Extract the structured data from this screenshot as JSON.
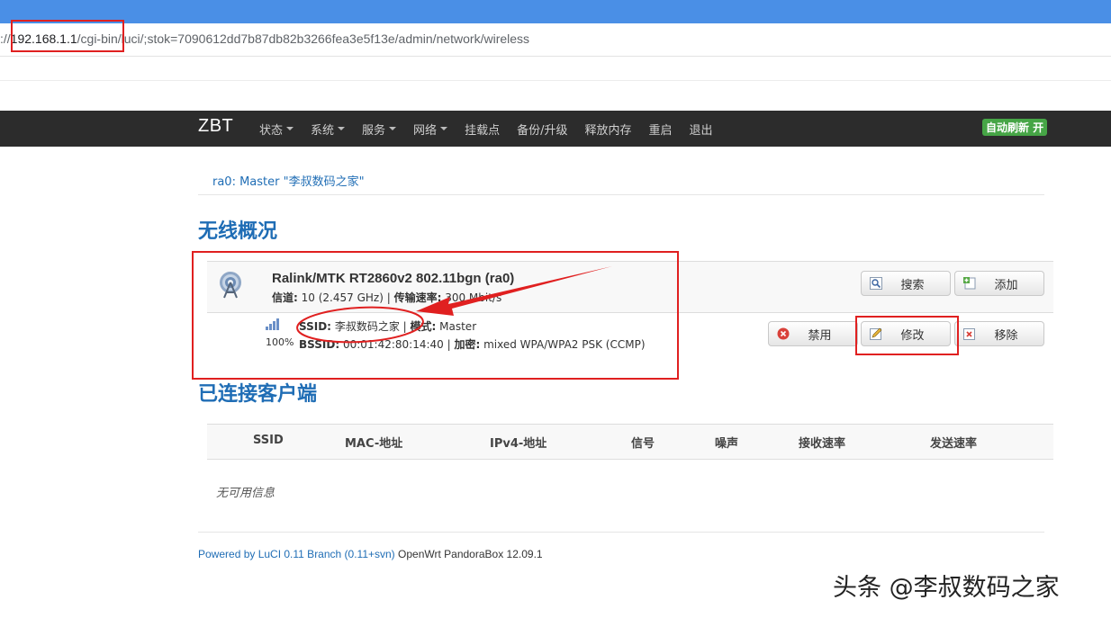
{
  "browser": {
    "url_prefix": "://",
    "url_host": "192.168.1.1",
    "url_rest": "/cgi-bin/luci/;stok=7090612dd7b87db82b3266fea3e5f13e/admin/network/wireless"
  },
  "navbar": {
    "brand": "ZBT",
    "menu": [
      {
        "label": "状态",
        "dropdown": true
      },
      {
        "label": "系统",
        "dropdown": true
      },
      {
        "label": "服务",
        "dropdown": true
      },
      {
        "label": "网络",
        "dropdown": true
      },
      {
        "label": "挂载点",
        "dropdown": false
      },
      {
        "label": "备份/升级",
        "dropdown": false
      },
      {
        "label": "释放内存",
        "dropdown": false
      },
      {
        "label": "重启",
        "dropdown": false
      },
      {
        "label": "退出",
        "dropdown": false
      }
    ],
    "refresh_badge": "自动刷新 开"
  },
  "breadcrumb": "ra0: Master \"李叔数码之家\"",
  "overview": {
    "heading": "无线概况",
    "device": {
      "title": "Ralink/MTK RT2860v2 802.11bgn (ra0)",
      "channel_label": "信道:",
      "channel_value": "10 (2.457 GHz)",
      "rate_label": "传输速率:",
      "rate_value": "300 Mbit/s",
      "scan_button": "搜索",
      "add_button": "添加"
    },
    "network": {
      "signal_percent": "100%",
      "ssid_label": "SSID:",
      "ssid_value": "李叔数码之家",
      "mode_label": "模式:",
      "mode_value": "Master",
      "bssid_label": "BSSID:",
      "bssid_value": "00:01:42:80:14:40",
      "enc_label": "加密:",
      "enc_value": "mixed WPA/WPA2 PSK (CCMP)",
      "disable_button": "禁用",
      "edit_button": "修改",
      "remove_button": "移除"
    }
  },
  "clients": {
    "heading": "已连接客户端",
    "columns": [
      "SSID",
      "MAC-地址",
      "IPv4-地址",
      "信号",
      "噪声",
      "接收速率",
      "发送速率"
    ],
    "empty_text": "无可用信息"
  },
  "footer": {
    "link_text": "Powered by LuCI 0.11 Branch (0.11+svn)",
    "rest_text": "OpenWrt PandoraBox 12.09.1"
  },
  "watermark": "头条 @李叔数码之家",
  "colors": {
    "accent": "#1f6db5",
    "navbar": "#2c2c2c",
    "annotation": "#e02020",
    "refresh_badge": "#46a546"
  }
}
